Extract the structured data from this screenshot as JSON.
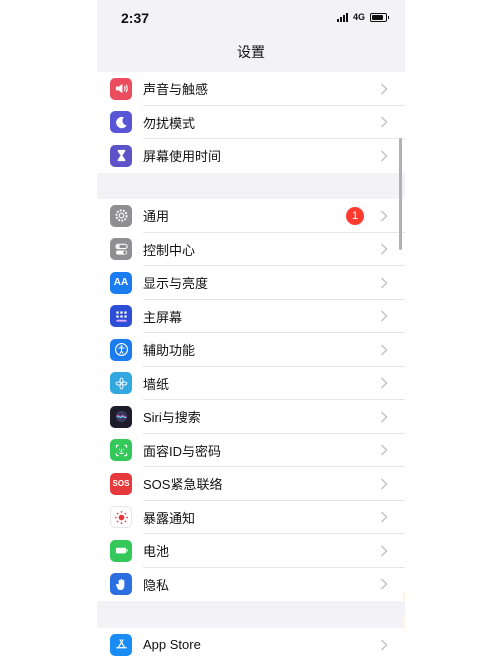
{
  "status": {
    "time": "2:37",
    "network": "4G"
  },
  "nav": {
    "title": "设置"
  },
  "groups": {
    "top": [
      {
        "label": "声音与触感",
        "icon": "speaker-icon",
        "color": "#eb4d5f"
      },
      {
        "label": "勿扰模式",
        "icon": "moon-icon",
        "color": "#5856d6"
      },
      {
        "label": "屏幕使用时间",
        "icon": "hourglass-icon",
        "color": "#5e52c9"
      }
    ],
    "middle": [
      {
        "label": "通用",
        "icon": "gear-icon",
        "color": "#8e8e93",
        "badge": "1"
      },
      {
        "label": "控制中心",
        "icon": "toggles-icon",
        "color": "#8e8e93"
      },
      {
        "label": "显示与亮度",
        "icon": "text-size-icon",
        "icon_text": "AA",
        "color": "#1a7cf0"
      },
      {
        "label": "主屏幕",
        "icon": "home-grid-icon",
        "color": "#2c4fd6"
      },
      {
        "label": "辅助功能",
        "icon": "accessibility-icon",
        "color": "#1a7cf0"
      },
      {
        "label": "墙纸",
        "icon": "flower-icon",
        "color": "#32a7e0"
      },
      {
        "label": "Siri与搜索",
        "icon": "siri-icon",
        "color": "#1c1c2a"
      },
      {
        "label": "面容ID与密码",
        "icon": "face-id-icon",
        "color": "#34c759"
      },
      {
        "label": "SOS紧急联络",
        "icon": "sos-icon",
        "icon_text": "SOS",
        "color": "#e5393b"
      },
      {
        "label": "暴露通知",
        "icon": "exposure-icon",
        "color": "#ffffff"
      },
      {
        "label": "电池",
        "icon": "battery-icon",
        "color": "#34c759"
      },
      {
        "label": "隐私",
        "icon": "hand-icon",
        "color": "#2c6fe0"
      }
    ],
    "bottom": [
      {
        "label": "App Store",
        "icon": "app-store-icon",
        "color": "#1a8cf5"
      }
    ]
  }
}
